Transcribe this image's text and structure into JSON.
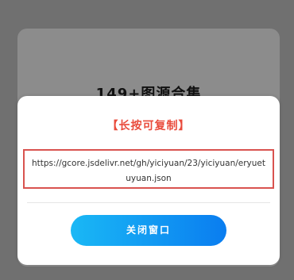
{
  "background": {
    "title": "149+图源合集"
  },
  "modal": {
    "title": "【长按可复制】",
    "url": "https://gcore.jsdelivr.net/gh/yiciyuan/23/yiciyuan/eryuetuyuan.json",
    "close_label": "关闭窗口"
  },
  "colors": {
    "title_red": "#e94b3c",
    "border_red": "#d9534f",
    "button_start": "#1ab8f5",
    "button_end": "#0a7df0"
  }
}
